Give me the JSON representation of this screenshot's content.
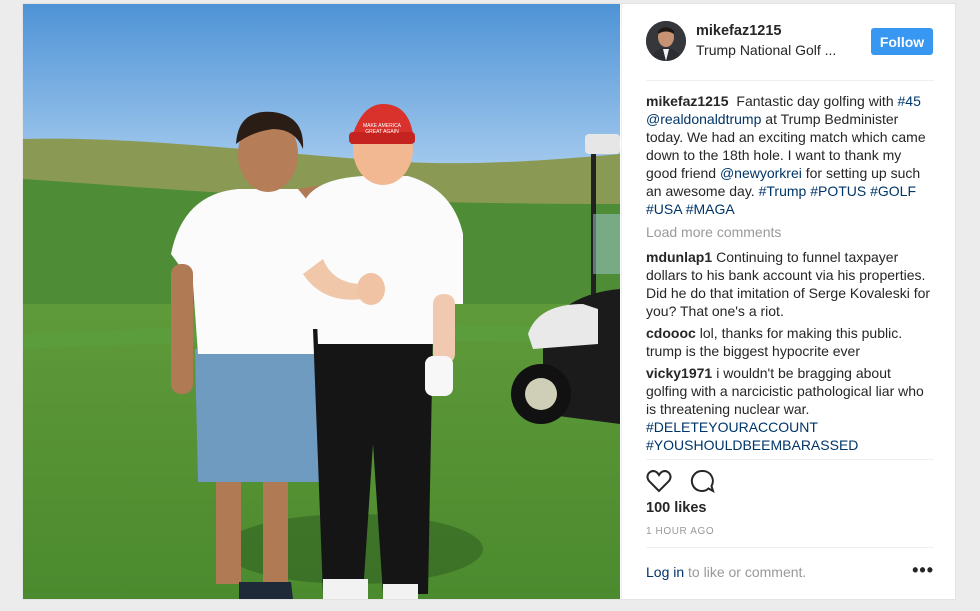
{
  "post": {
    "username": "mikefaz1215",
    "location": "Trump National Golf ...",
    "follow_label": "Follow",
    "caption": {
      "user": "mikefaz1215",
      "parts": [
        {
          "text": "Fantastic day golfing with ",
          "link": false
        },
        {
          "text": "#45",
          "link": true
        },
        {
          "text": " ",
          "link": false
        },
        {
          "text": "@realdonaldtrump",
          "link": true
        },
        {
          "text": " at Trump Bedminister today. We had an exciting match which came down to the 18th hole. I want to thank my good friend ",
          "link": false
        },
        {
          "text": "@newyorkrei",
          "link": true
        },
        {
          "text": " for setting up such an awesome day. ",
          "link": false
        },
        {
          "text": "#Trump",
          "link": true
        },
        {
          "text": " ",
          "link": false
        },
        {
          "text": "#POTUS",
          "link": true
        },
        {
          "text": " ",
          "link": false
        },
        {
          "text": "#GOLF",
          "link": true
        },
        {
          "text": " ",
          "link": false
        },
        {
          "text": "#USA",
          "link": true
        },
        {
          "text": " ",
          "link": false
        },
        {
          "text": "#MAGA",
          "link": true
        }
      ]
    },
    "load_more_label": "Load more comments",
    "comments": [
      {
        "user": "mdunlap1",
        "parts": [
          {
            "text": "Continuing to funnel taxpayer dollars to his bank account via his properties. Did he do that imitation of Serge Kovaleski for you? That one's a riot.",
            "link": false
          }
        ]
      },
      {
        "user": "cdoooc",
        "parts": [
          {
            "text": "lol, thanks for making this public. trump is the biggest hypocrite ever",
            "link": false
          }
        ]
      },
      {
        "user": "vicky1971",
        "parts": [
          {
            "text": "i wouldn't be bragging about golfing with a narcicistic pathological liar who is threatening nuclear war. ",
            "link": false
          },
          {
            "text": "#DELETEYOURACCOUNT",
            "link": true
          },
          {
            "text": " ",
            "link": false
          },
          {
            "text": "#YOUSHOULDBEEMBARASSED",
            "link": true
          }
        ]
      }
    ],
    "likes": "100 likes",
    "timestamp": "1 HOUR AGO",
    "login_link": "Log in",
    "login_suffix": " to like or comment.",
    "more_options": "•••",
    "icons": {
      "like": "heart-icon",
      "comment": "comment-icon",
      "more": "more-options-icon"
    },
    "colors": {
      "follow_button": "#3897f0",
      "link": "#003569",
      "muted": "#999999",
      "text": "#262626"
    },
    "photo_hat_text": "MAKE AMERICA GREAT AGAIN"
  }
}
